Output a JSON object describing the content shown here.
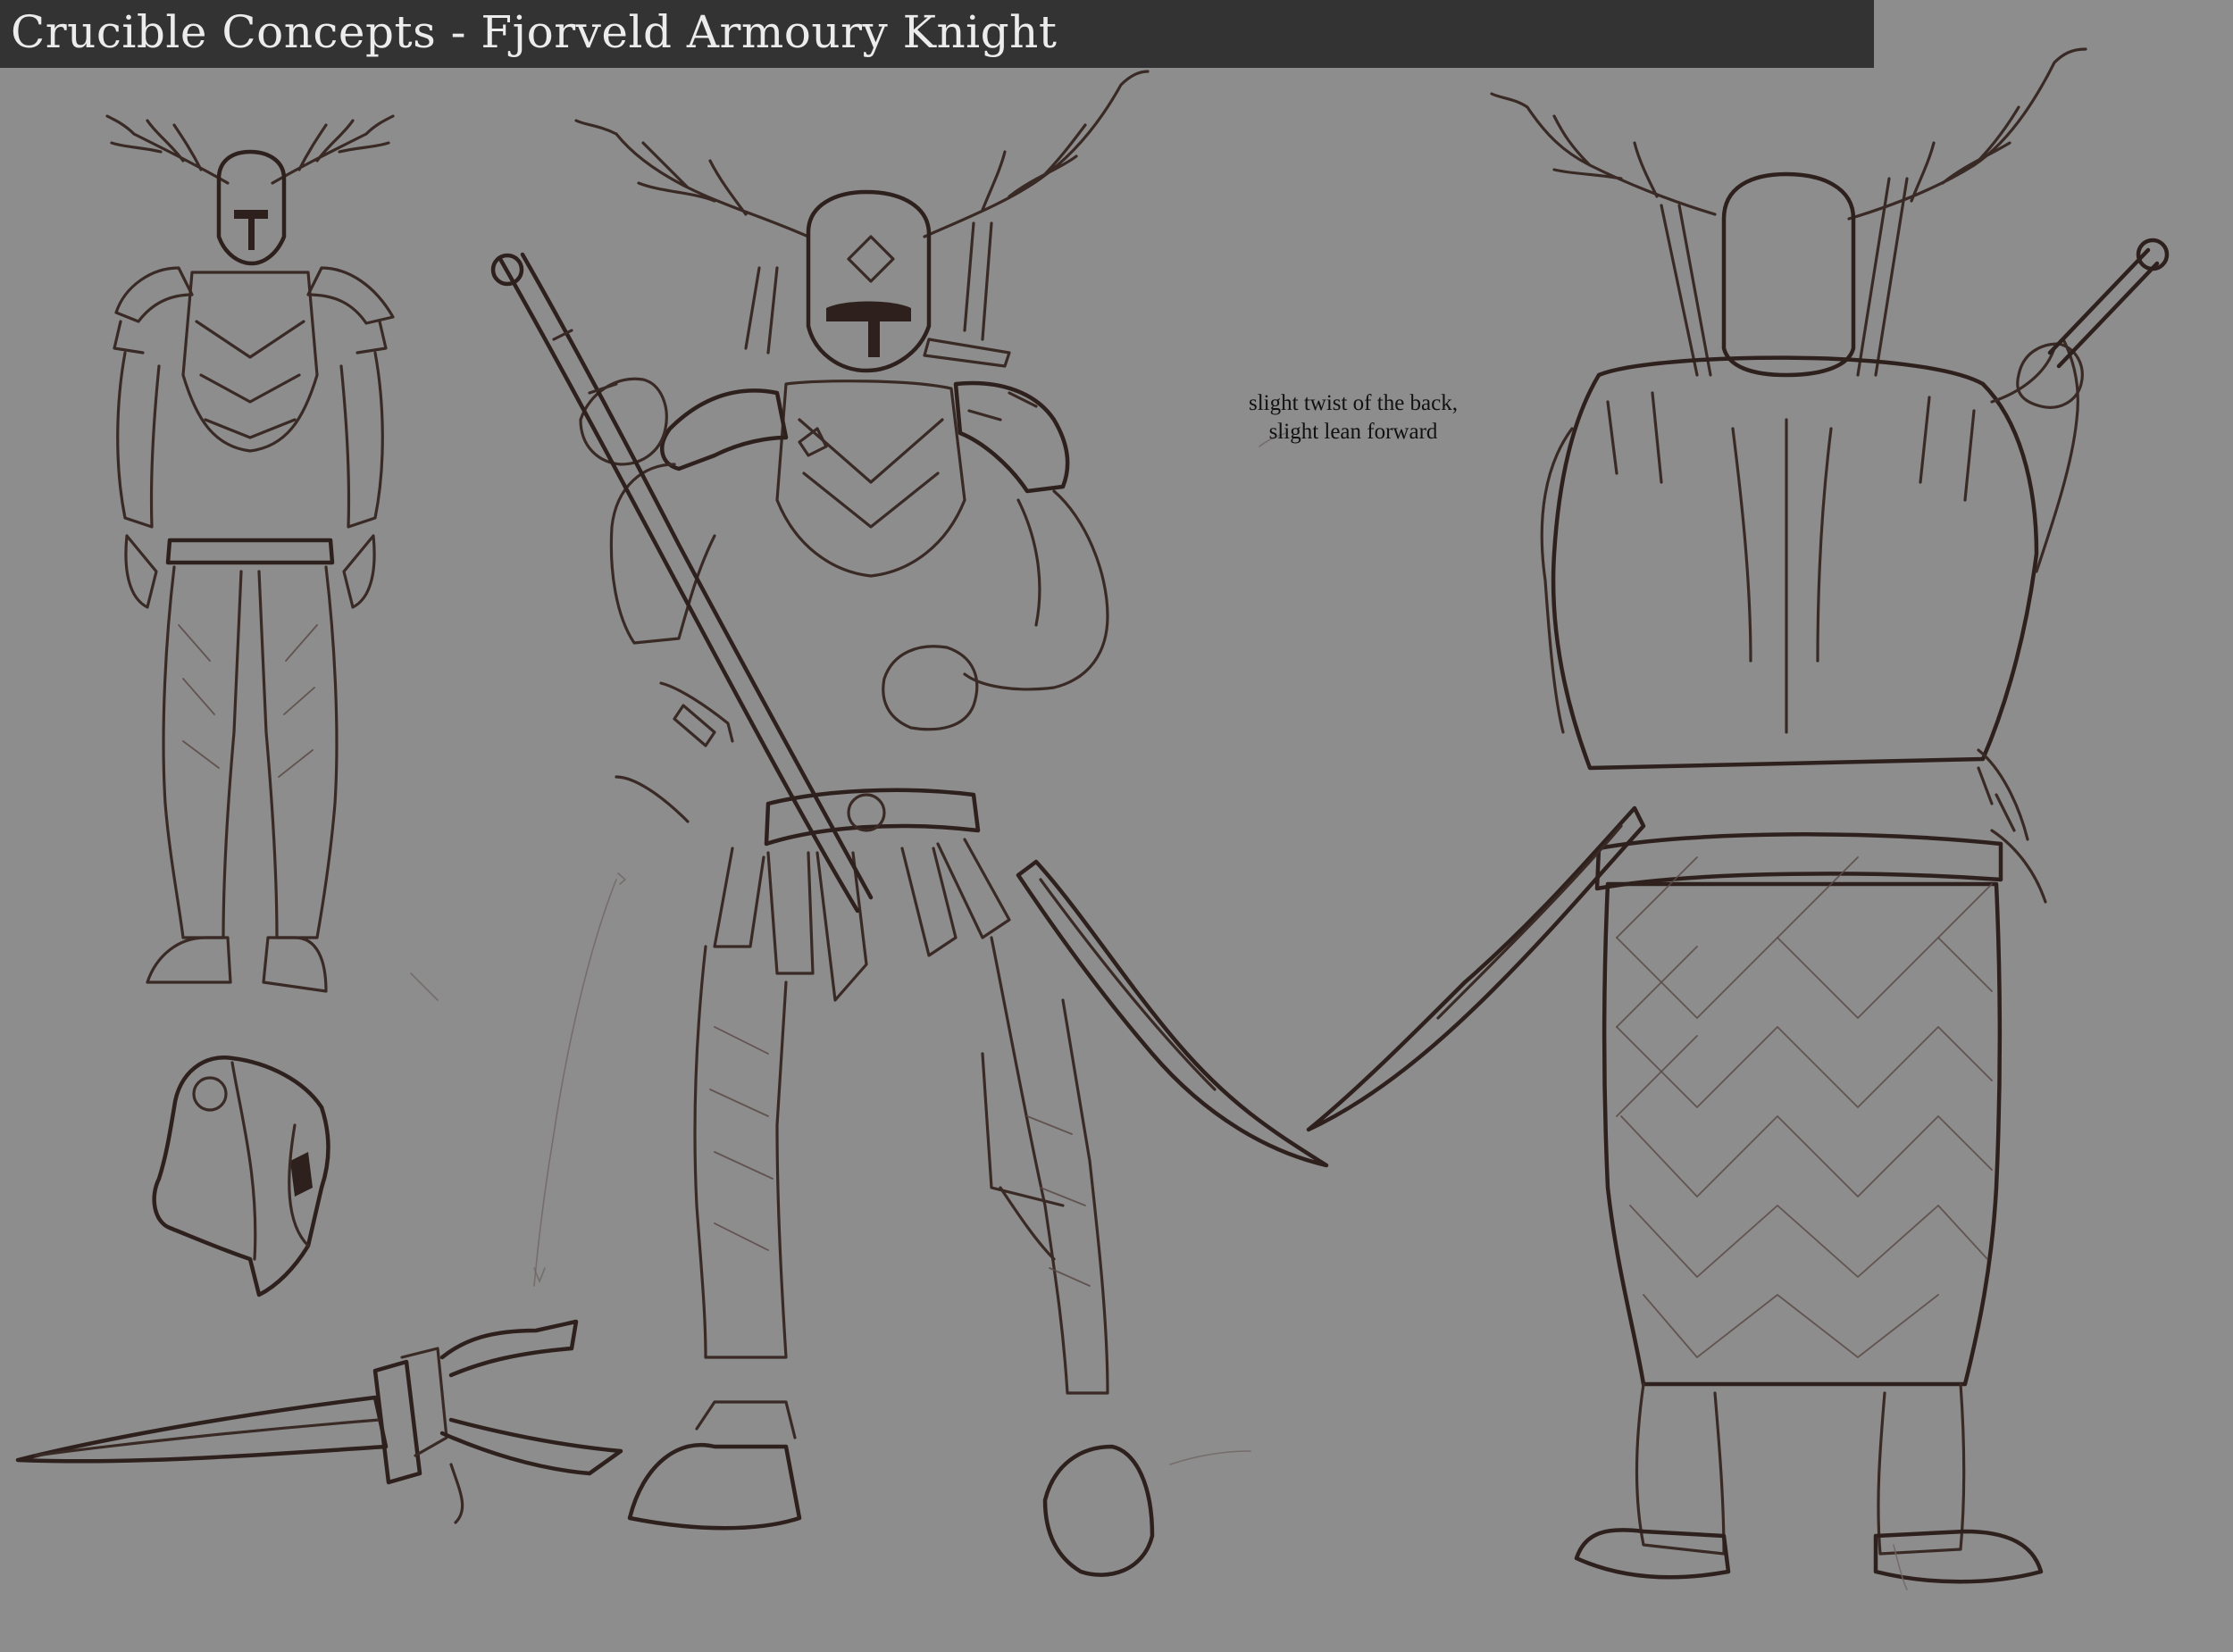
{
  "title": "Crucible Concepts -  Fjorveld Armoury Knight",
  "annotation": {
    "line1": "slight twist of the back,",
    "line2": "slight lean forward"
  },
  "colors": {
    "background": "#8d8d8d",
    "title_bar": "#333333",
    "title_text": "#ececec",
    "line_art": "#3a2a26"
  }
}
